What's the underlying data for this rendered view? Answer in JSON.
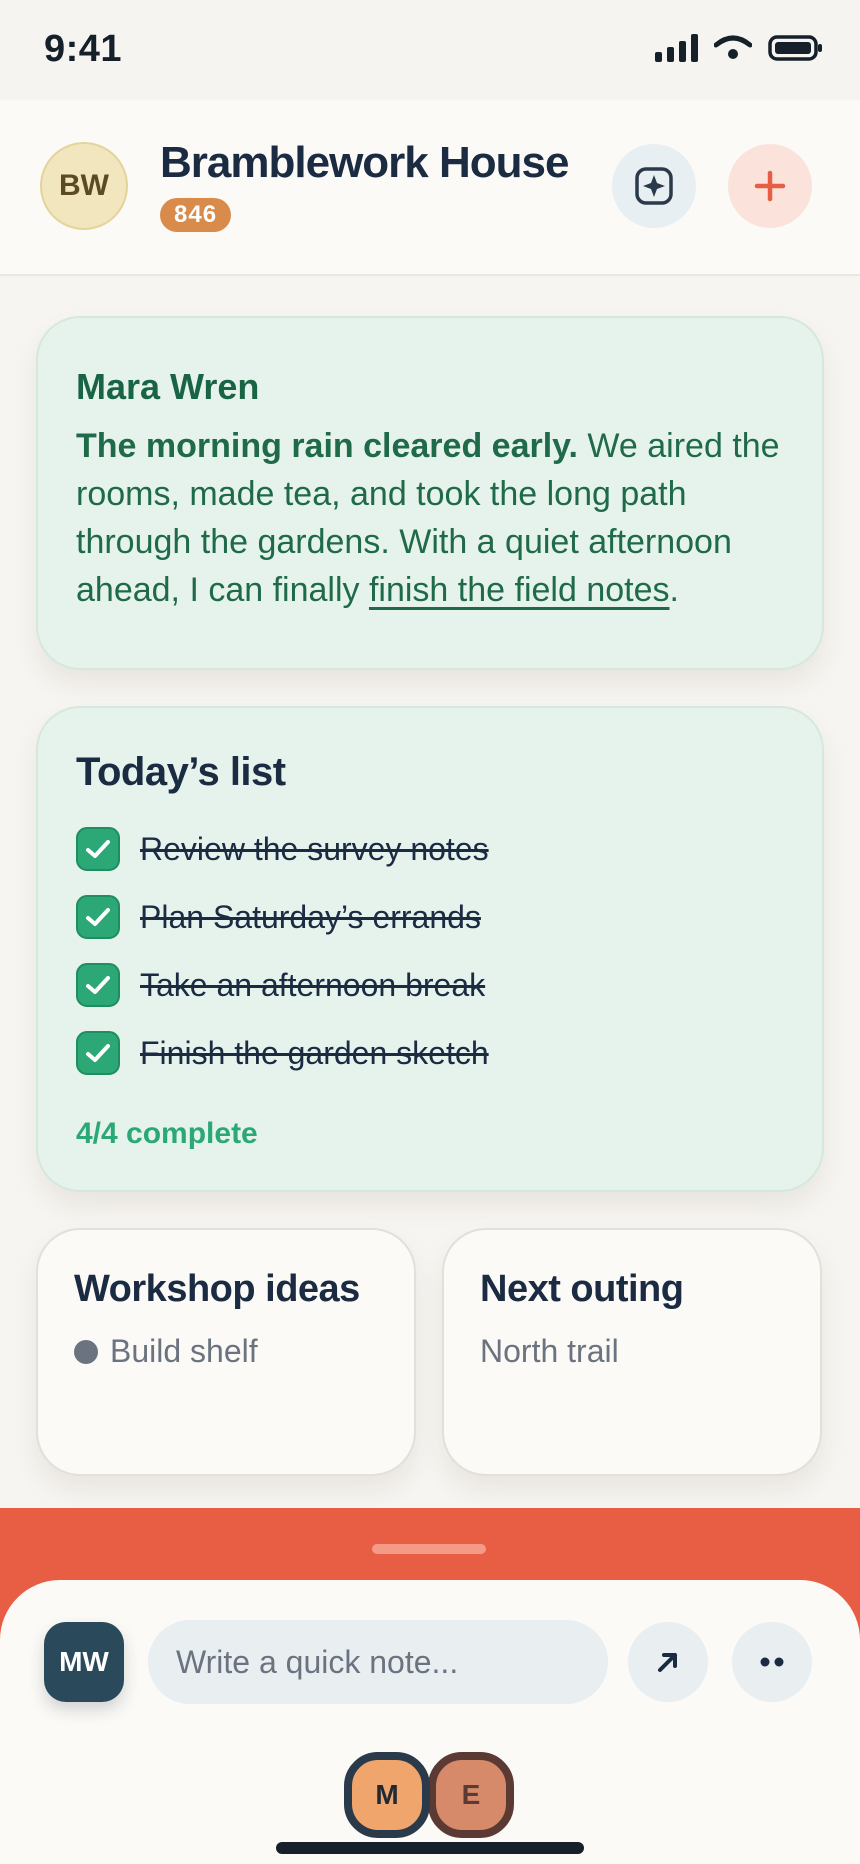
{
  "status_bar": {
    "time": "9:41"
  },
  "header": {
    "avatar_initials": "BW",
    "title": "Bramblework House",
    "badge": "846",
    "sparkle_icon": "sparkle-icon",
    "add_icon": "plus-icon"
  },
  "note": {
    "author": "Mara Wren",
    "lead": "The morning rain cleared early.",
    "body": " We aired the rooms, made tea, and took the long path through the gardens. With a quiet afternoon ahead, I can finally ",
    "link": "finish the field notes",
    "end": "."
  },
  "todo": {
    "title": "Today’s list",
    "items": [
      {
        "label": "Review the survey notes",
        "done": true
      },
      {
        "label": "Plan Saturday’s errands",
        "done": true
      },
      {
        "label": "Take an afternoon break",
        "done": true
      },
      {
        "label": "Finish the garden sketch",
        "done": true
      }
    ],
    "progress": "4/4 complete"
  },
  "cards": {
    "workshop": {
      "title": "Workshop ideas",
      "item": "Build shelf"
    },
    "outing": {
      "title": "Next outing",
      "item": "North trail"
    }
  },
  "composer": {
    "avatar_initials": "MW",
    "placeholder": "Write a quick note...",
    "send_icon": "arrow-up-right-icon",
    "more_icon": "more-dots-icon"
  },
  "presence": {
    "first": "M",
    "second": "E"
  },
  "colors": {
    "accent": "#e85e45",
    "green": "#2ba876",
    "badge": "#d88b4a",
    "navy": "#1a2b42"
  }
}
